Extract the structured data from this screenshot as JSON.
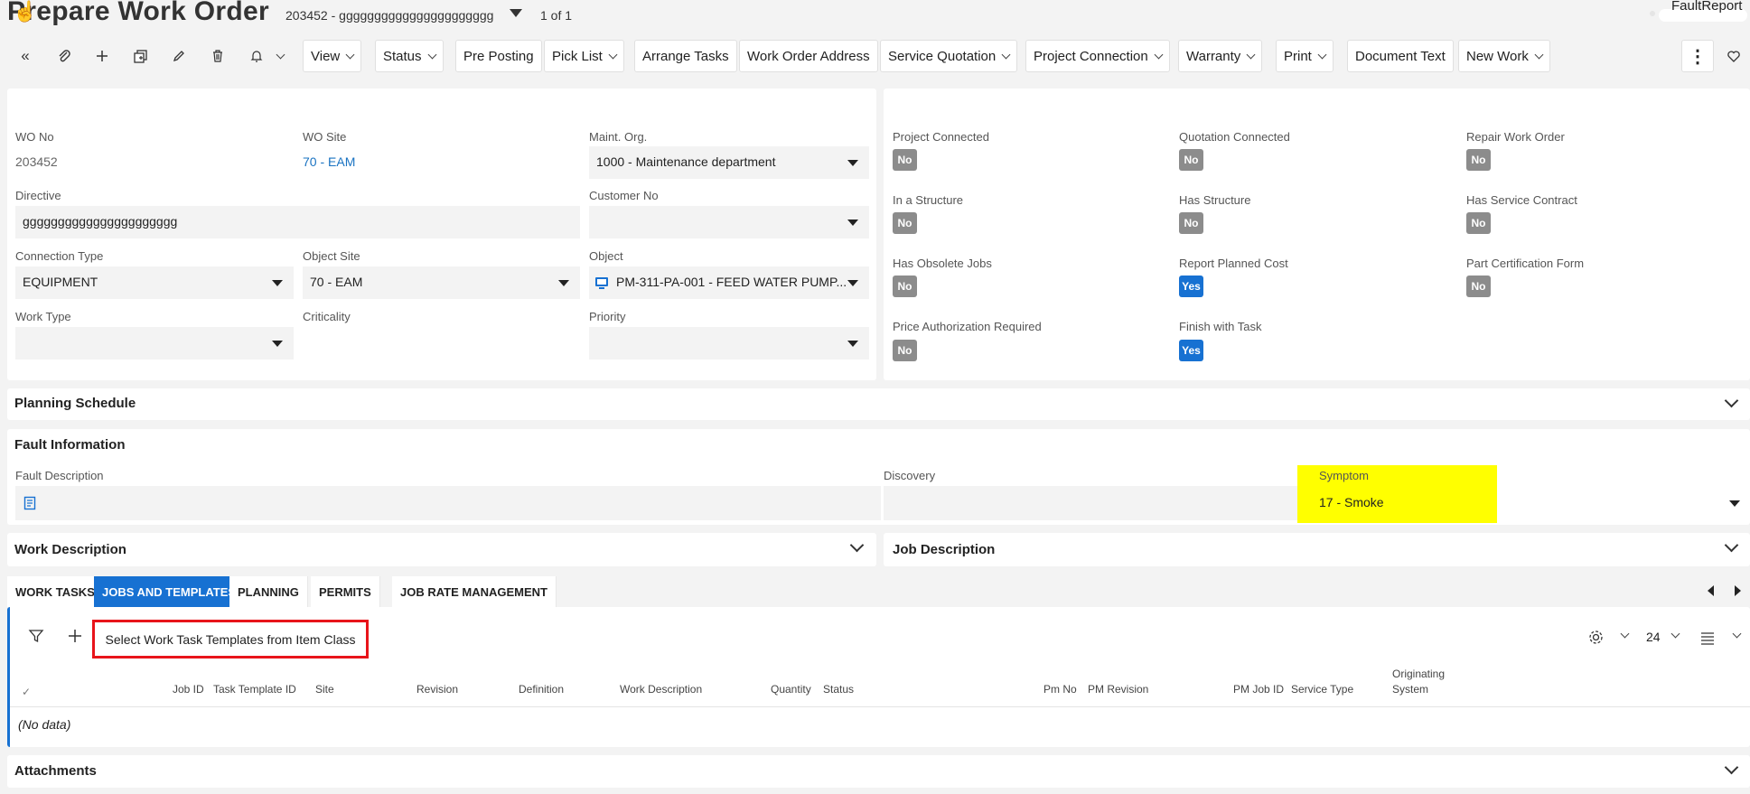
{
  "header": {
    "title": "Prepare Work Order",
    "record_selector": "203452 - gggggggggggggggggggggg",
    "record_count": "1 of 1",
    "fault_report_label": "FaultReport"
  },
  "toolbar": {
    "icons": [
      "collapse-icon",
      "attachment-icon",
      "add-icon",
      "duplicate-icon",
      "edit-icon",
      "delete-icon",
      "bell-icon"
    ],
    "buttons": [
      "View",
      "Status",
      "Pre Posting",
      "Pick List",
      "Arrange Tasks",
      "Work Order Address",
      "Service Quotation",
      "Project Connection",
      "Warranty",
      "Print",
      "Document Text",
      "New Work"
    ]
  },
  "form": {
    "wo_no_label": "WO No",
    "wo_no": "203452",
    "wo_site_label": "WO Site",
    "wo_site": "70 - EAM",
    "maint_org_label": "Maint. Org.",
    "maint_org": "1000 - Maintenance department",
    "directive_label": "Directive",
    "directive": "gggggggggggggggggggggg",
    "customer_no_label": "Customer No",
    "customer_no": "",
    "connection_type_label": "Connection Type",
    "connection_type": "EQUIPMENT",
    "object_site_label": "Object Site",
    "object_site": "70 - EAM",
    "object_label": "Object",
    "object": "PM-311-PA-001 - FEED WATER PUMP...",
    "work_type_label": "Work Type",
    "work_type": "",
    "criticality_label": "Criticality",
    "priority_label": "Priority",
    "priority": ""
  },
  "flags": [
    {
      "label": "Project Connected",
      "value": "No"
    },
    {
      "label": "Quotation Connected",
      "value": "No"
    },
    {
      "label": "Repair Work Order",
      "value": "No"
    },
    {
      "label": "In a Structure",
      "value": "No"
    },
    {
      "label": "Has Structure",
      "value": "No"
    },
    {
      "label": "Has Service Contract",
      "value": "No"
    },
    {
      "label": "Has Obsolete Jobs",
      "value": "No"
    },
    {
      "label": "Report Planned Cost",
      "value": "Yes"
    },
    {
      "label": "Part Certification Form",
      "value": "No"
    },
    {
      "label": "Price Authorization Required",
      "value": "No"
    },
    {
      "label": "Finish with Task",
      "value": "Yes"
    }
  ],
  "sections": {
    "planning_schedule": "Planning Schedule",
    "fault_information": "Fault Information",
    "work_description": "Work Description",
    "job_description": "Job Description",
    "attachments": "Attachments"
  },
  "fault": {
    "fault_description_label": "Fault Description",
    "discovery_label": "Discovery",
    "discovery": "",
    "symptom_label": "Symptom",
    "symptom": "17 - Smoke"
  },
  "tabs": [
    "WORK TASKS",
    "JOBS AND TEMPLATES",
    "PLANNING",
    "PERMITS",
    "JOB RATE MANAGEMENT"
  ],
  "active_tab": "JOBS AND TEMPLATES",
  "grid": {
    "action_button": "Select Work Task Templates from Item Class",
    "page_size": "24",
    "columns": [
      "Job ID",
      "Task Template ID",
      "Site",
      "Revision",
      "Definition",
      "Work Description",
      "Quantity",
      "Status",
      "Pm No",
      "PM Revision",
      "PM Job ID",
      "Service Type",
      "Originating",
      "System"
    ],
    "empty_text": "(No data)"
  },
  "colors": {
    "accent": "#1771d2",
    "highlight": "#ffff00",
    "annotation_box": "#e8141a"
  }
}
